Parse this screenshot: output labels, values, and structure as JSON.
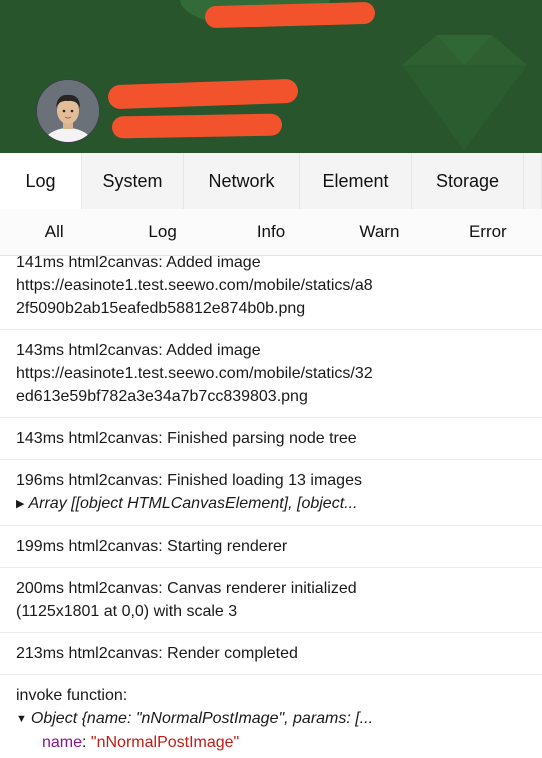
{
  "header": {
    "accent_color": "#28552c",
    "redaction_color": "#f2532d",
    "avatar_icon": "user-avatar"
  },
  "top_tabs": [
    {
      "label": "Log",
      "active": true
    },
    {
      "label": "System",
      "active": false
    },
    {
      "label": "Network",
      "active": false
    },
    {
      "label": "Element",
      "active": false
    },
    {
      "label": "Storage",
      "active": false
    }
  ],
  "sub_tabs": [
    "All",
    "Log",
    "Info",
    "Warn",
    "Error"
  ],
  "logs": [
    {
      "lines": [
        "141ms html2canvas: Added image",
        "https://easinote1.test.seewo.com/mobile/statics/a8",
        "2f5090b2ab15eafedb58812e874b0b.png"
      ]
    },
    {
      "lines": [
        "143ms html2canvas: Added image",
        "https://easinote1.test.seewo.com/mobile/statics/32",
        "ed613e59bf782a3e34a7b7cc839803.png"
      ]
    },
    {
      "lines": [
        "143ms html2canvas: Finished parsing node tree"
      ]
    },
    {
      "lines": [
        "196ms html2canvas: Finished loading 13 images"
      ],
      "object": "Array [[object HTMLCanvasElement], [object..."
    },
    {
      "lines": [
        "199ms html2canvas: Starting renderer"
      ]
    },
    {
      "lines": [
        "200ms html2canvas: Canvas renderer initialized",
        "(1125x1801 at 0,0) with scale 3"
      ]
    },
    {
      "lines": [
        "213ms html2canvas: Render completed"
      ]
    },
    {
      "lines": [
        "invoke function:"
      ],
      "object_expanded": "Object {name: \"nNormalPostImage\", params: [...",
      "props": [
        {
          "key": "name",
          "value": "\"nNormalPostImage\""
        },
        {
          "key": "params",
          "type": "Object"
        }
      ]
    }
  ]
}
